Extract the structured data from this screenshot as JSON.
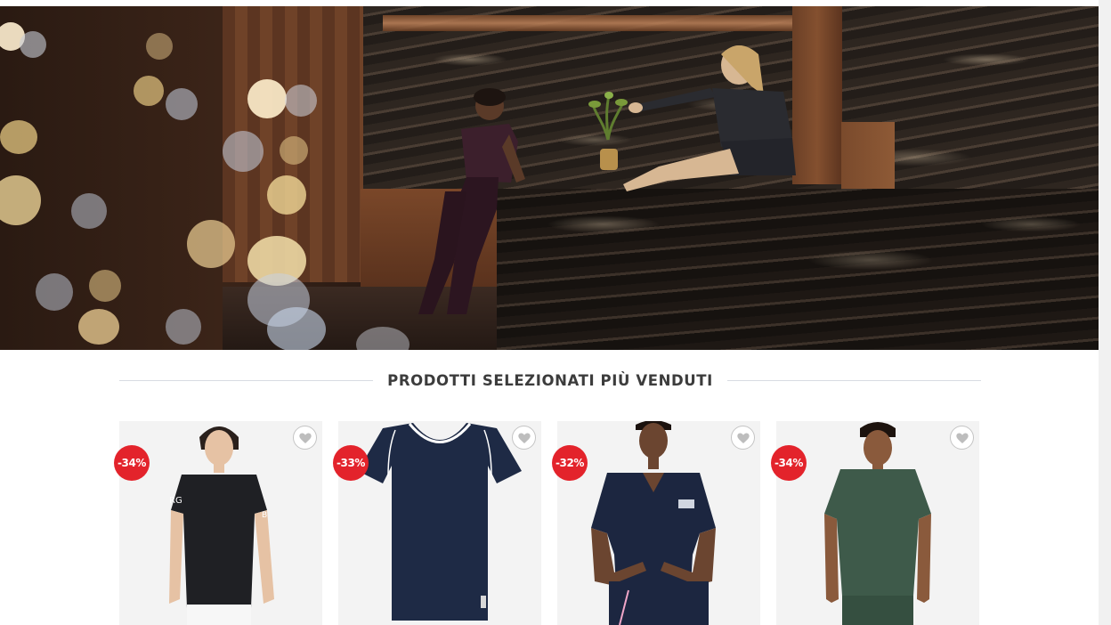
{
  "hero": {
    "image": "kitchen-lifestyle-hero"
  },
  "section": {
    "title": "PRODOTTI SELEZIONATI PIÙ VENDUTI"
  },
  "products": [
    {
      "discount": "-34%",
      "color": "black",
      "image": "black-tshirt-model"
    },
    {
      "discount": "-33%",
      "color": "navy",
      "image": "navy-vneck-tshirt"
    },
    {
      "discount": "-32%",
      "color": "navy",
      "image": "navy-vneck-tshirt-model"
    },
    {
      "discount": "-34%",
      "color": "green",
      "image": "green-tshirt-model"
    }
  ],
  "theme": {
    "badge_color": "#e3232b",
    "title_color": "#3c3c3c",
    "divider_color": "#d8dbe2"
  },
  "icons": {
    "wishlist": "heart-icon"
  }
}
